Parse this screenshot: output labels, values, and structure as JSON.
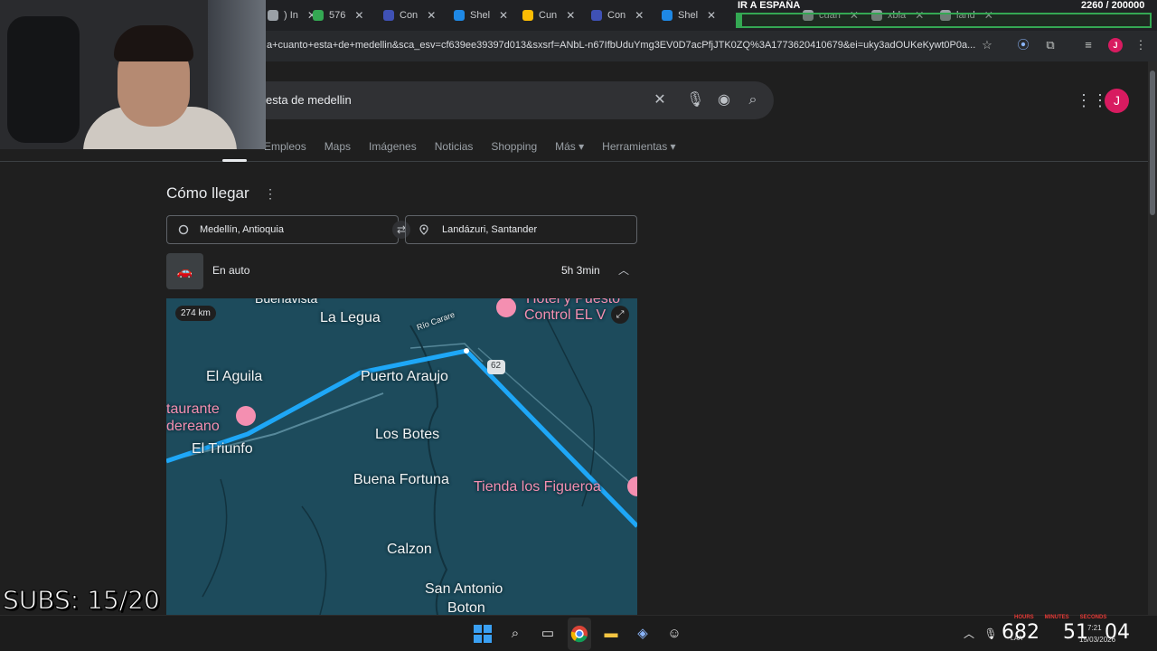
{
  "browser": {
    "tabs": [
      {
        "label": ") In",
        "color": "#9aa0a6"
      },
      {
        "label": "576",
        "color": "#34a853"
      },
      {
        "label": "Con",
        "color": "#3f51b5"
      },
      {
        "label": "Shel",
        "color": "#1e88e5"
      },
      {
        "label": "Cun",
        "color": "#fbbc04"
      },
      {
        "label": "Con",
        "color": "#3f51b5"
      },
      {
        "label": "Shel",
        "color": "#1e88e5"
      },
      {
        "label": "cuan",
        "color": "#9aa0a6"
      },
      {
        "label": "xbla",
        "color": "#9aa0a6"
      },
      {
        "label": "land",
        "color": "#9aa0a6"
      }
    ],
    "url": "a+cuanto+esta+de+medellin&sca_esv=cf639ee39397d013&sxsrf=ANbL-n67IfbUduYmg3EV0D7acPfjJTK0ZQ%3A1773620410679&ei=uky3adOUKeKywt0P0a...",
    "profile_initial": "J"
  },
  "search": {
    "query": "esta de medellin",
    "tabs": [
      "Empleos",
      "Maps",
      "Imágenes",
      "Noticias",
      "Shopping",
      "Más ▾",
      "Herramientas ▾"
    ],
    "account_initial": "J"
  },
  "directions": {
    "title": "Cómo llegar",
    "origin": "Medellín, Antioquia",
    "destination": "Landázuri, Santander",
    "mode": "En auto",
    "duration": "5h 3min",
    "distance": "274 km"
  },
  "map": {
    "labels": [
      {
        "text": "Buenavista",
        "pink": false
      },
      {
        "text": "La Legua",
        "pink": false
      },
      {
        "text": "Hotel y Puesto",
        "pink": true
      },
      {
        "text": "Control EL V",
        "pink": true
      },
      {
        "text": "Río Carare",
        "pink": false
      },
      {
        "text": "El Aguila",
        "pink": false
      },
      {
        "text": "Puerto Araujo",
        "pink": false
      },
      {
        "text": "62",
        "pink": false
      },
      {
        "text": "taurante",
        "pink": true
      },
      {
        "text": "dereano",
        "pink": true
      },
      {
        "text": "El Triunfo",
        "pink": false
      },
      {
        "text": "Los Botes",
        "pink": false
      },
      {
        "text": "Buena Fortuna",
        "pink": false
      },
      {
        "text": "Tienda los Figueroa",
        "pink": true
      },
      {
        "text": "Calzon",
        "pink": false
      },
      {
        "text": "San Antonio",
        "pink": false
      },
      {
        "text": "Boton",
        "pink": false
      }
    ],
    "route_color": "#1ea7f7"
  },
  "overlay": {
    "goal_title": "IR A ESPAÑA",
    "goal_count": "2260 / 200000",
    "goal_progress": 0.0113,
    "subs": "SUBS: 15/20",
    "counter_a": "682",
    "counter_b": "51",
    "counter_c": "04",
    "timer_labels": [
      "HOURS",
      "MINUTES",
      "SECONDS"
    ],
    "clock_time": "7:21",
    "clock_date": "15/03/2026",
    "lang": "LAA"
  }
}
